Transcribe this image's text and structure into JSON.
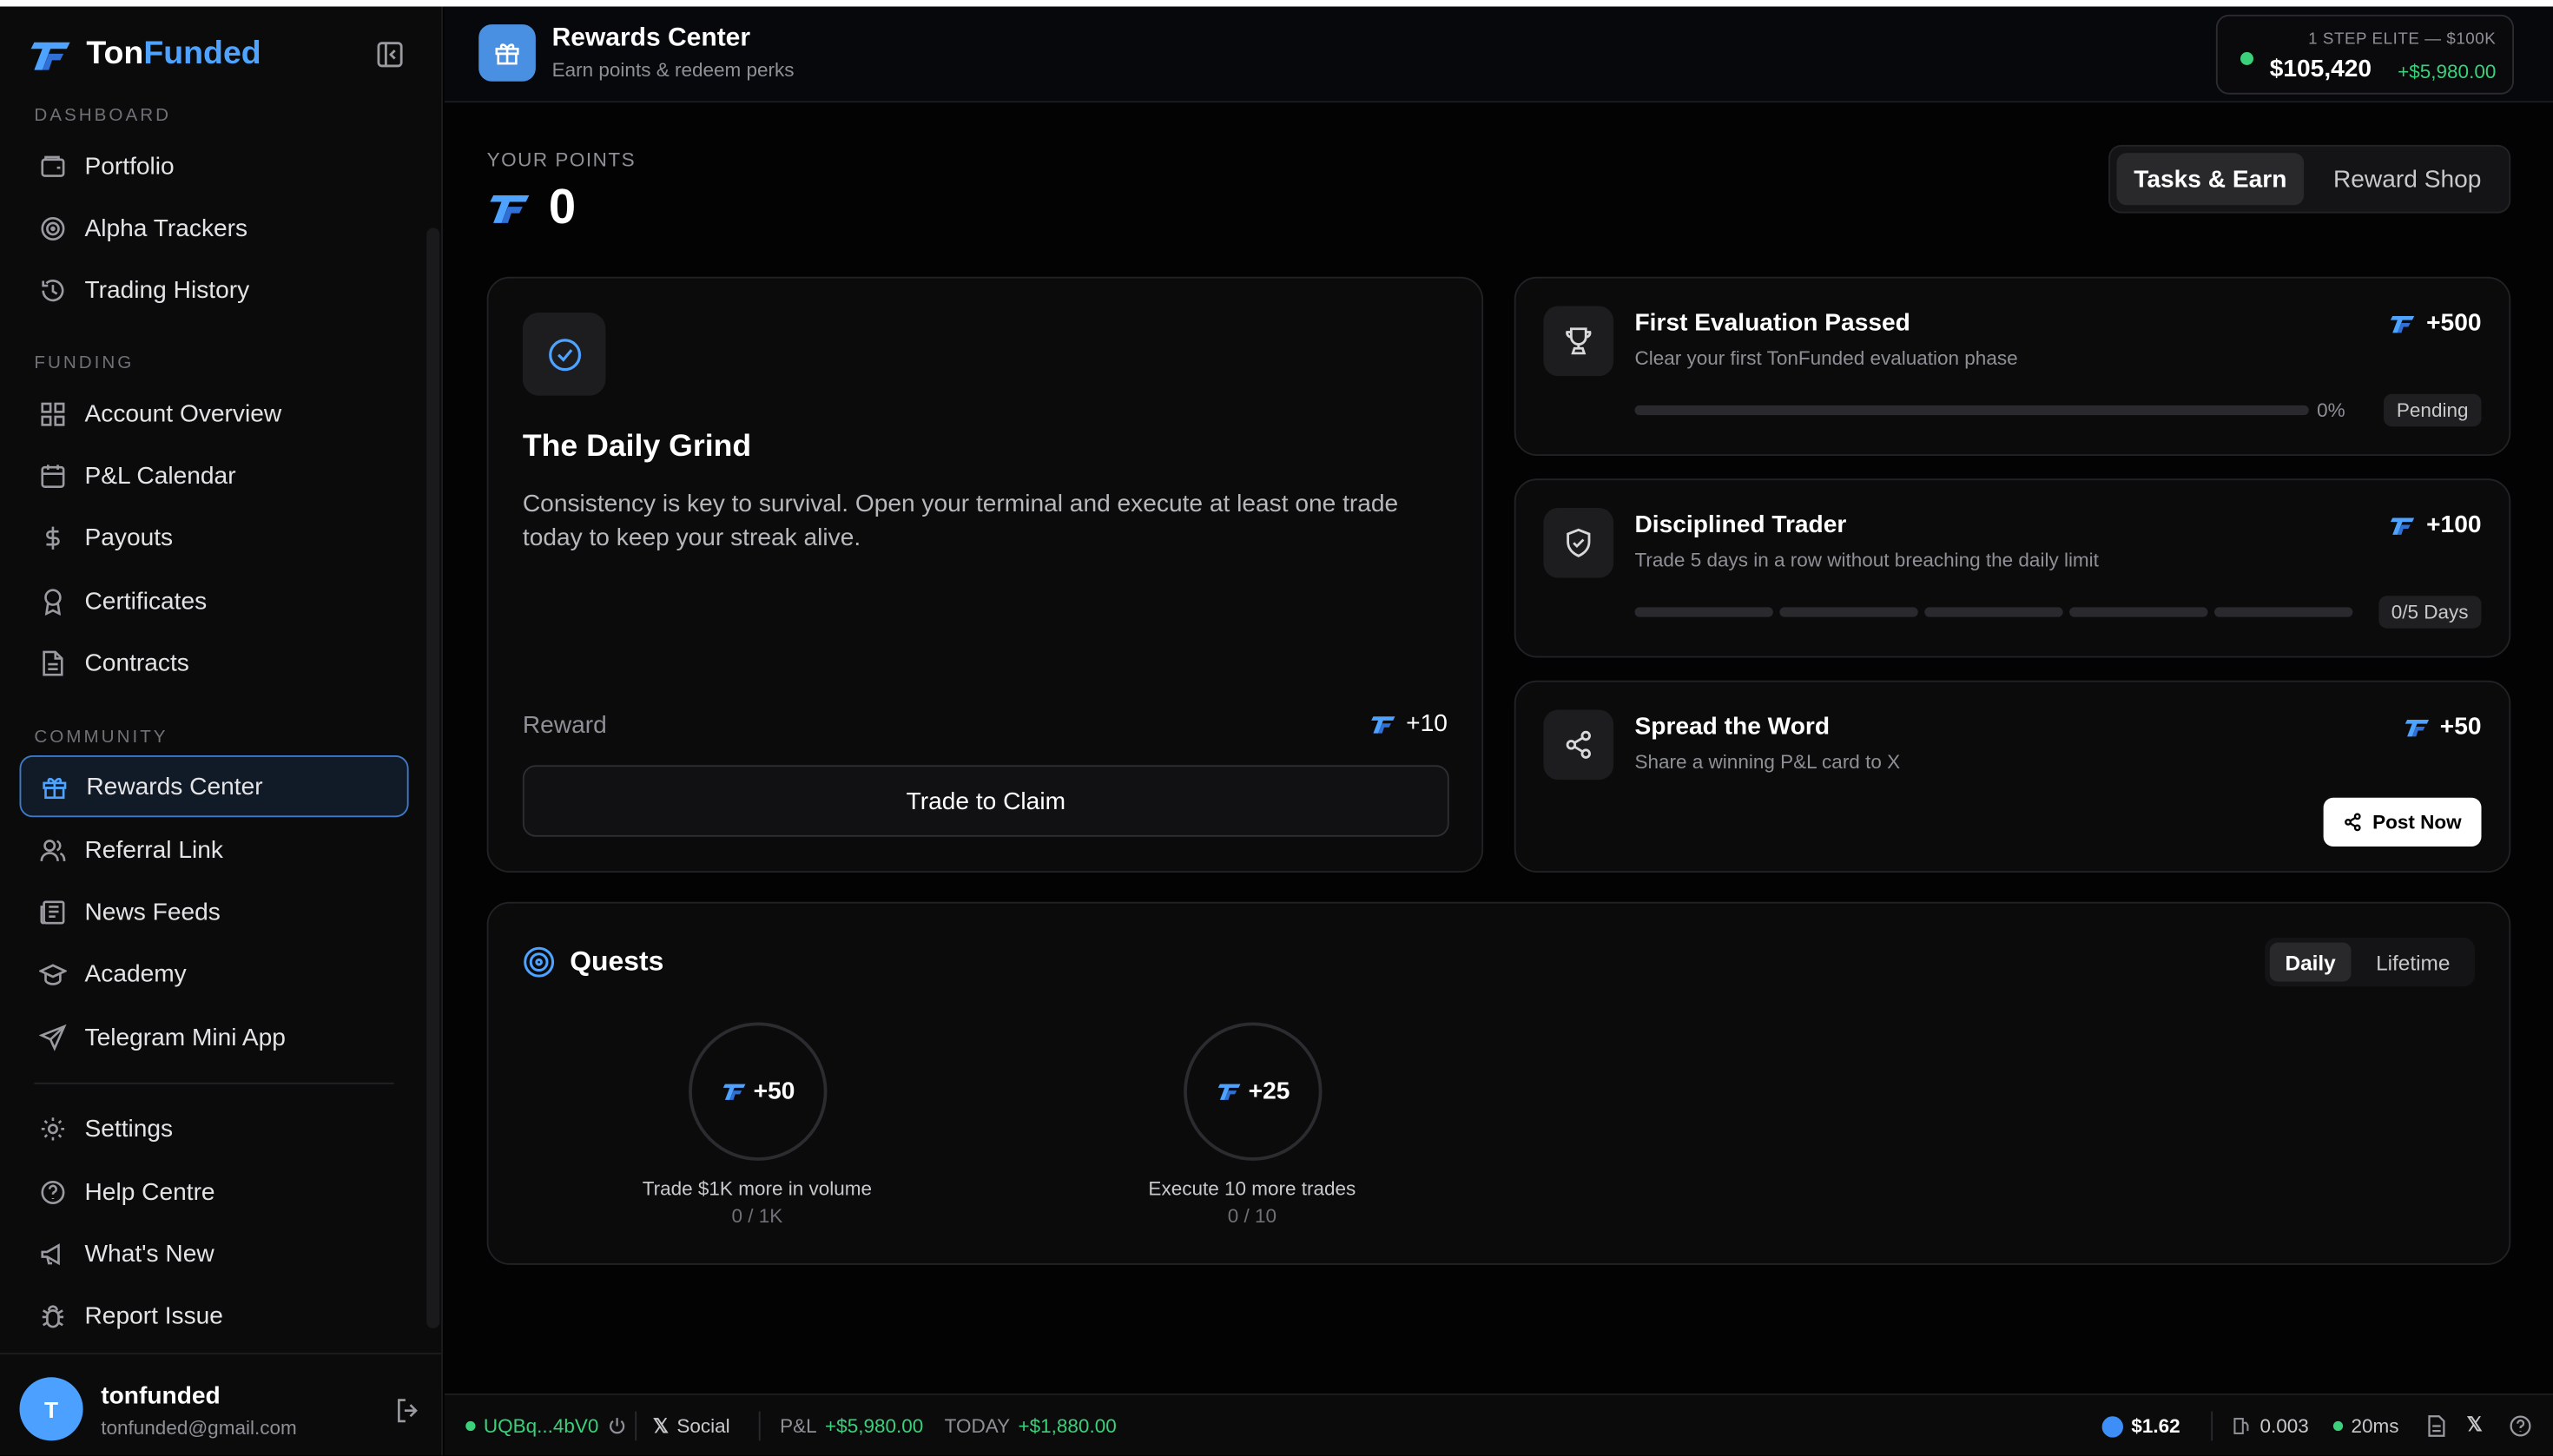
{
  "brand": {
    "part1": "Ton",
    "part2": "Funded"
  },
  "sidebar": {
    "sections": {
      "dashboard": "DASHBOARD",
      "funding": "FUNDING",
      "community": "COMMUNITY"
    },
    "items": [
      "Portfolio",
      "Alpha Trackers",
      "Trading History",
      "Account Overview",
      "P&L Calendar",
      "Payouts",
      "Certificates",
      "Contracts",
      "Rewards Center",
      "Referral Link",
      "News Feeds",
      "Academy",
      "Telegram Mini App",
      "Settings",
      "Help Centre",
      "What's New",
      "Report Issue"
    ],
    "active": "Rewards Center"
  },
  "user": {
    "initial": "T",
    "name": "tonfunded",
    "email": "tonfunded@gmail.com"
  },
  "header": {
    "title": "Rewards Center",
    "subtitle": "Earn points & redeem perks"
  },
  "account": {
    "label": "1 STEP ELITE — $100K",
    "balance": "$105,420",
    "pnl": "+$5,980.00"
  },
  "points": {
    "label": "YOUR POINTS",
    "value": "0"
  },
  "tabs": {
    "tasks": "Tasks & Earn",
    "shop": "Reward Shop",
    "active": "Tasks & Earn"
  },
  "daily": {
    "title": "The Daily Grind",
    "desc": "Consistency is key to survival. Open your terminal and execute at least one trade today to keep your streak alive.",
    "reward_label": "Reward",
    "reward": "+10",
    "button": "Trade to Claim"
  },
  "tasks": [
    {
      "title": "First Evaluation Passed",
      "desc": "Clear your first TonFunded evaluation phase",
      "reward": "+500",
      "progress_text": "0%",
      "progress": 0,
      "status": "Pending"
    },
    {
      "title": "Disciplined Trader",
      "desc": "Trade 5 days in a row without breaching the daily limit",
      "reward": "+100",
      "progress": 0,
      "segments": 5,
      "status": "0/5 Days"
    },
    {
      "title": "Spread the Word",
      "desc": "Share a winning P&L card to X",
      "reward": "+50",
      "button": "Post Now"
    }
  ],
  "quests": {
    "title": "Quests",
    "tabs": {
      "daily": "Daily",
      "lifetime": "Lifetime",
      "active": "Daily"
    },
    "items": [
      {
        "reward": "+50",
        "label": "Trade $1K more in volume",
        "progress": "0 / 1K"
      },
      {
        "reward": "+25",
        "label": "Execute 10 more trades",
        "progress": "0 / 10"
      }
    ]
  },
  "footer": {
    "wallet": "UQBq...4bV0",
    "social": "Social",
    "pnl_label": "P&L",
    "pnl": "+$5,980.00",
    "today_label": "TODAY",
    "today": "+$1,880.00",
    "price": "$1.62",
    "gas": "0.003",
    "latency": "20ms"
  },
  "colors": {
    "accent": "#4da3ff",
    "positive": "#3ad17a",
    "active_border": "#3d79c8"
  }
}
